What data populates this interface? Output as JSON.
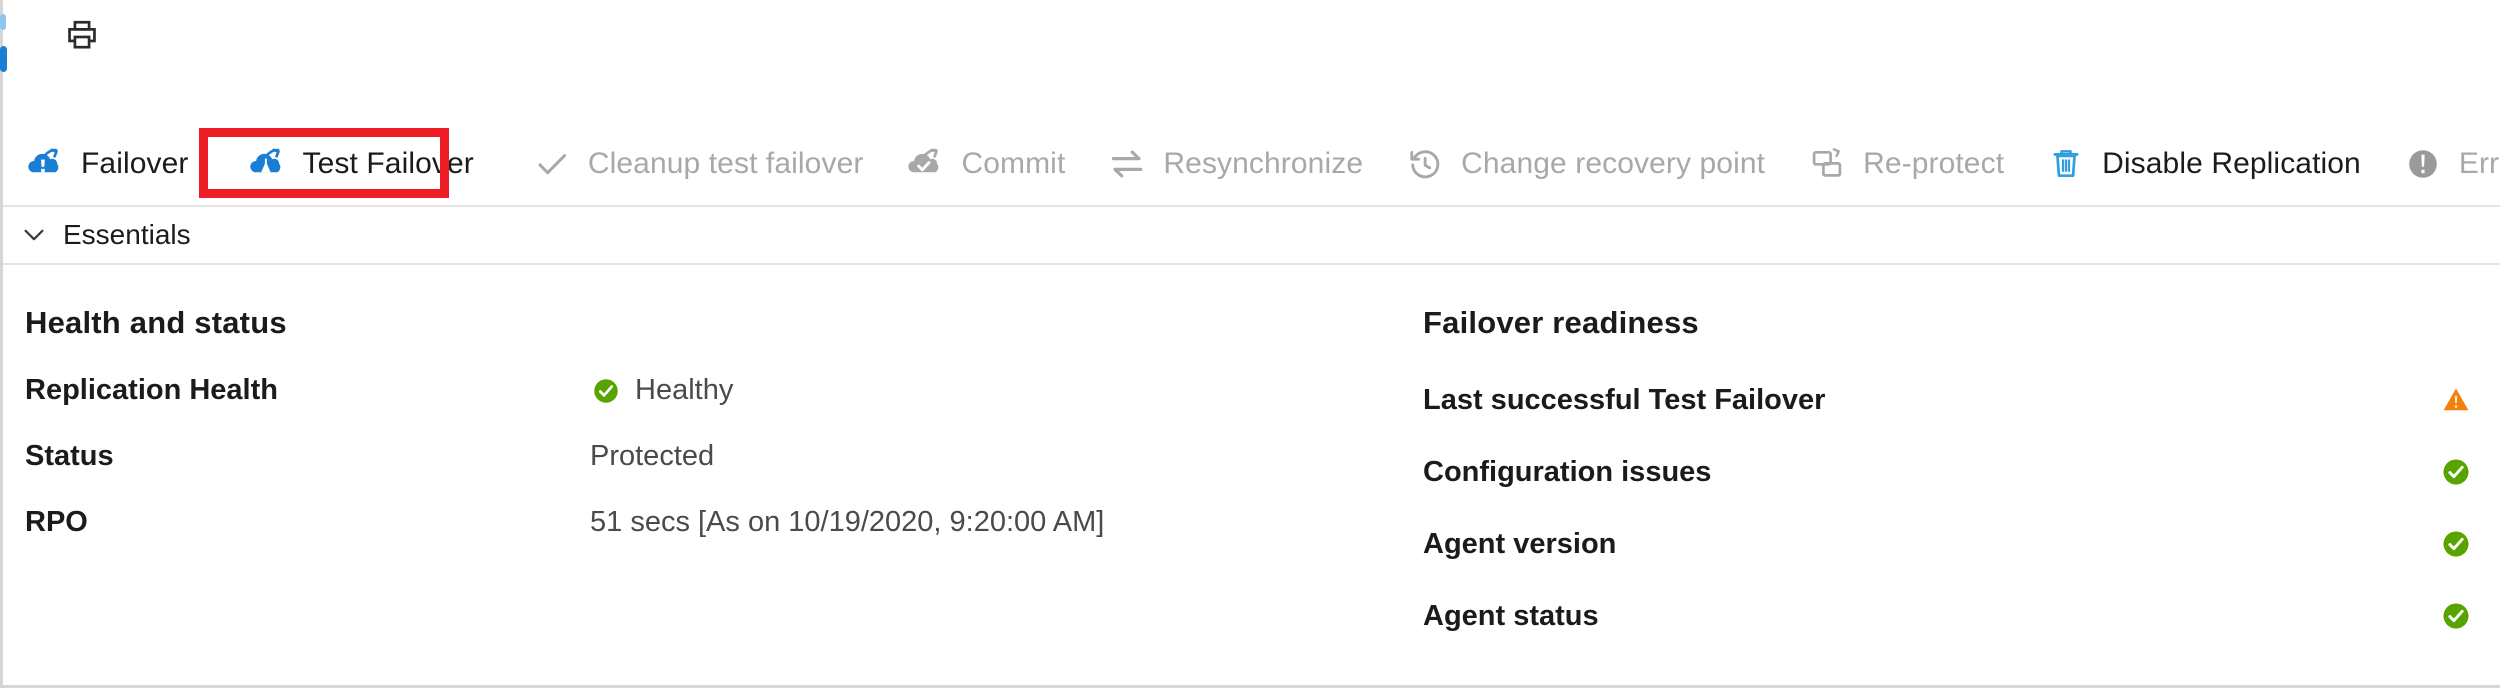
{
  "topbar": {
    "print_label": "print-icon"
  },
  "commandbar": {
    "items": [
      {
        "label": "Failover",
        "icon": "failover-icon",
        "enabled": true
      },
      {
        "label": "Test Failover",
        "icon": "test-failover-icon",
        "enabled": true
      },
      {
        "label": "Cleanup test failover",
        "icon": "checkmark-icon",
        "enabled": false
      },
      {
        "label": "Commit",
        "icon": "commit-icon",
        "enabled": false
      },
      {
        "label": "Resynchronize",
        "icon": "resynchronize-icon",
        "enabled": false
      },
      {
        "label": "Change recovery point",
        "icon": "clock-history-icon",
        "enabled": false
      },
      {
        "label": "Re-protect",
        "icon": "reprotect-icon",
        "enabled": false
      },
      {
        "label": "Disable Replication",
        "icon": "trash-icon",
        "enabled": true
      },
      {
        "label": "Error Details",
        "icon": "error-icon",
        "enabled": false
      }
    ],
    "refresh": {
      "label": "",
      "icon": "refresh-icon"
    },
    "highlighted_item": "Test Failover",
    "highlight_color": "#ee1c25"
  },
  "essentials": {
    "label": "Essentials",
    "chevron": "chevron-down-icon",
    "expanded": true
  },
  "health_and_status": {
    "title": "Health and status",
    "rows": [
      {
        "key": "Replication Health",
        "value": "Healthy",
        "icon": "success-check-icon"
      },
      {
        "key": "Status",
        "value": "Protected",
        "icon": ""
      },
      {
        "key": "RPO",
        "value": "51 secs [As on 10/19/2020, 9:20:00 AM]",
        "icon": ""
      }
    ]
  },
  "failover_readiness": {
    "title": "Failover readiness",
    "rows": [
      {
        "key": "Last successful Test Failover",
        "status": "warning",
        "icon": "warning-triangle-icon"
      },
      {
        "key": "Configuration issues",
        "status": "success",
        "icon": "success-check-icon"
      },
      {
        "key": "Agent version",
        "status": "success",
        "icon": "success-check-icon"
      },
      {
        "key": "Agent status",
        "status": "success",
        "icon": "success-check-icon"
      }
    ]
  },
  "colors": {
    "accent_blue": "#1a7fd4",
    "success_green": "#57a300",
    "warning_orange": "#f2820c",
    "disabled_grey": "#a8a8a8",
    "highlight_red": "#ee1c25",
    "text": "#1b1b1b"
  }
}
